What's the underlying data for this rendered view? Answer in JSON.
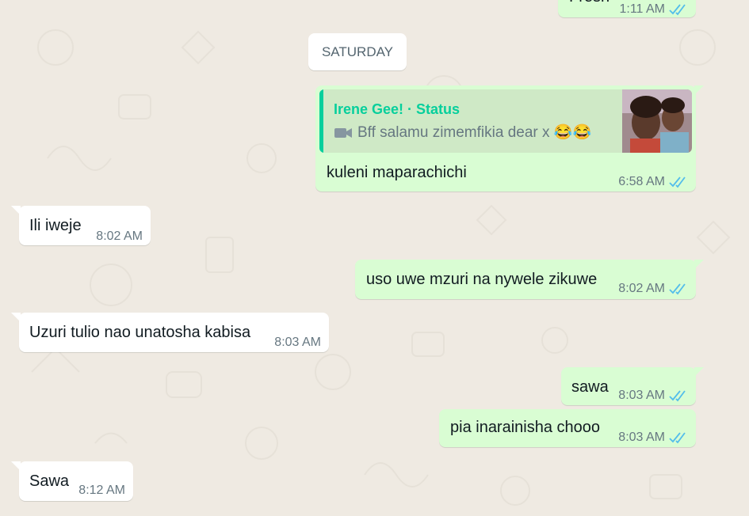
{
  "colors": {
    "background": "#efeae2",
    "outgoing_bubble": "#d9fdd3",
    "incoming_bubble": "#ffffff",
    "read_ticks": "#53bdeb",
    "quote_accent": "#06cf9c"
  },
  "date_separator": "SATURDAY",
  "messages": [
    {
      "dir": "out",
      "text": "Fresh",
      "time": "1:11 AM",
      "status": "read-double-tick-icon"
    },
    {
      "dir": "out",
      "quote": {
        "author": "Irene Gee! · Status",
        "icon": "video-camera-icon",
        "text": "Bff salamu  zimemfikia dear x 😂😂"
      },
      "text": "kuleni maparachichi",
      "time": "6:58 AM",
      "status": "read-double-tick-icon"
    },
    {
      "dir": "in",
      "text": "Ili iweje",
      "time": "8:02 AM"
    },
    {
      "dir": "out",
      "text": "uso uwe mzuri na nywele zikuwe",
      "time": "8:02 AM",
      "status": "read-double-tick-icon"
    },
    {
      "dir": "in",
      "text": "Uzuri tulio nao unatosha kabisa",
      "time": "8:03 AM"
    },
    {
      "dir": "out",
      "text": "sawa",
      "time": "8:03 AM",
      "status": "read-double-tick-icon"
    },
    {
      "dir": "out",
      "text": "pia inarainisha chooo",
      "time": "8:03 AM",
      "status": "read-double-tick-icon"
    },
    {
      "dir": "in",
      "text": "Sawa",
      "time": "8:12 AM"
    }
  ]
}
